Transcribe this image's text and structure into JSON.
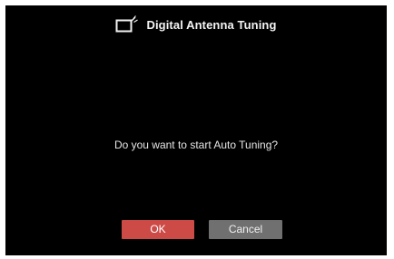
{
  "dialog": {
    "title": "Digital Antenna Tuning",
    "icon": "tv-antenna-icon",
    "message": "Do you want to start Auto Tuning?"
  },
  "buttons": {
    "ok_label": "OK",
    "cancel_label": "Cancel"
  },
  "colors": {
    "background": "#000000",
    "ok_button": "#cc4b47",
    "cancel_button": "#707070",
    "text": "#e6e6e6"
  }
}
